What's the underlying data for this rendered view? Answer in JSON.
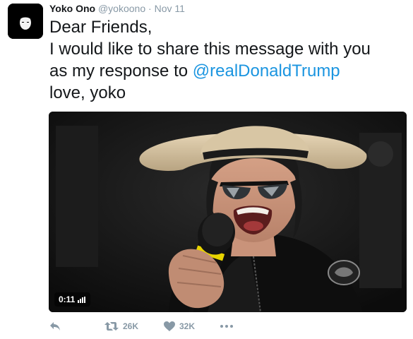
{
  "tweet": {
    "author_name": "Yoko Ono",
    "handle": "@yokoono",
    "separator": "·",
    "date": "Nov 11",
    "text_lines": [
      "Dear Friends,",
      "I would like to share this message with you",
      "as my response to "
    ],
    "mention": "@realDonaldTrump",
    "signoff": "love, yoko",
    "media": {
      "type": "video",
      "duration": "0:11"
    },
    "actions": {
      "reply_icon": "reply-icon",
      "retweet_icon": "retweet-icon",
      "retweet_count": "26K",
      "like_icon": "heart-icon",
      "like_count": "32K",
      "more_icon": "more-icon"
    }
  },
  "colors": {
    "text": "#14171a",
    "muted": "#8899a6",
    "mention": "#1b95e0"
  }
}
